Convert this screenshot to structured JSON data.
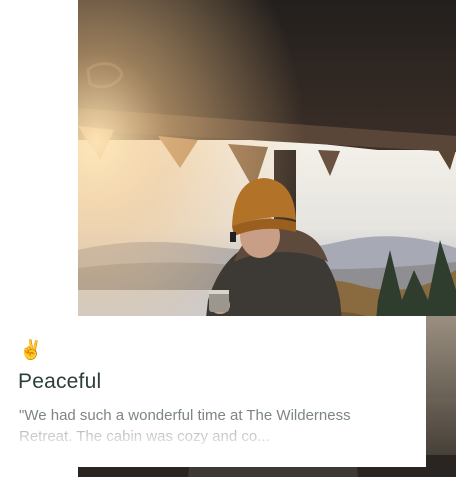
{
  "photo": {
    "description_icon": "mountain-lookout-photo"
  },
  "card": {
    "emoji": "✌️",
    "title": "Peaceful",
    "excerpt": "\"We had such a wonderful time at The Wilderness Retreat. The cabin was cozy and co..."
  },
  "colors": {
    "title": "#2d3f3a",
    "excerpt": "#7d8587",
    "card_bg": "#ffffff"
  }
}
